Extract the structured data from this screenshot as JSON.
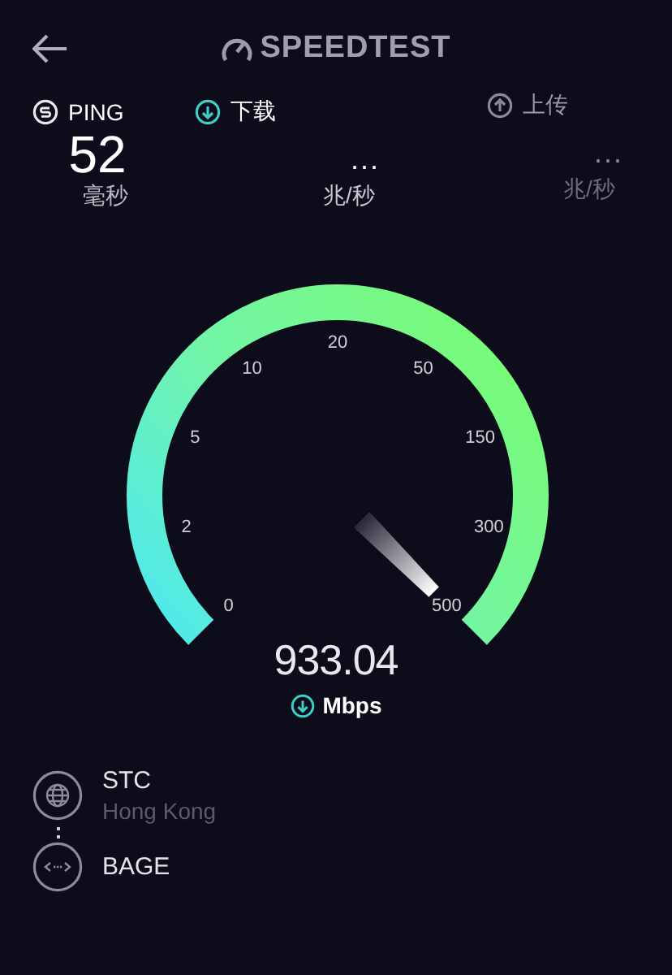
{
  "header": {
    "logo_text": "SPEEDTEST"
  },
  "metrics": [
    {
      "kind": "ping",
      "label": "PING",
      "selected": false,
      "disabled": false,
      "value": "52",
      "unit": "毫秒"
    },
    {
      "kind": "download",
      "label": "下载",
      "selected": true,
      "disabled": false,
      "value": "...",
      "unit": "兆/秒"
    },
    {
      "kind": "upload",
      "label": "上传",
      "selected": false,
      "disabled": true,
      "value": "...",
      "unit": "兆/秒"
    }
  ],
  "gauge": {
    "ticks": [
      "0",
      "2",
      "5",
      "10",
      "20",
      "50",
      "150",
      "300",
      "500"
    ],
    "reading": "933.04",
    "unit": "Mbps"
  },
  "servers": [
    {
      "kind": "provider",
      "name": "STC",
      "location": "Hong Kong"
    },
    {
      "kind": "host",
      "name": "BAGE"
    }
  ]
}
